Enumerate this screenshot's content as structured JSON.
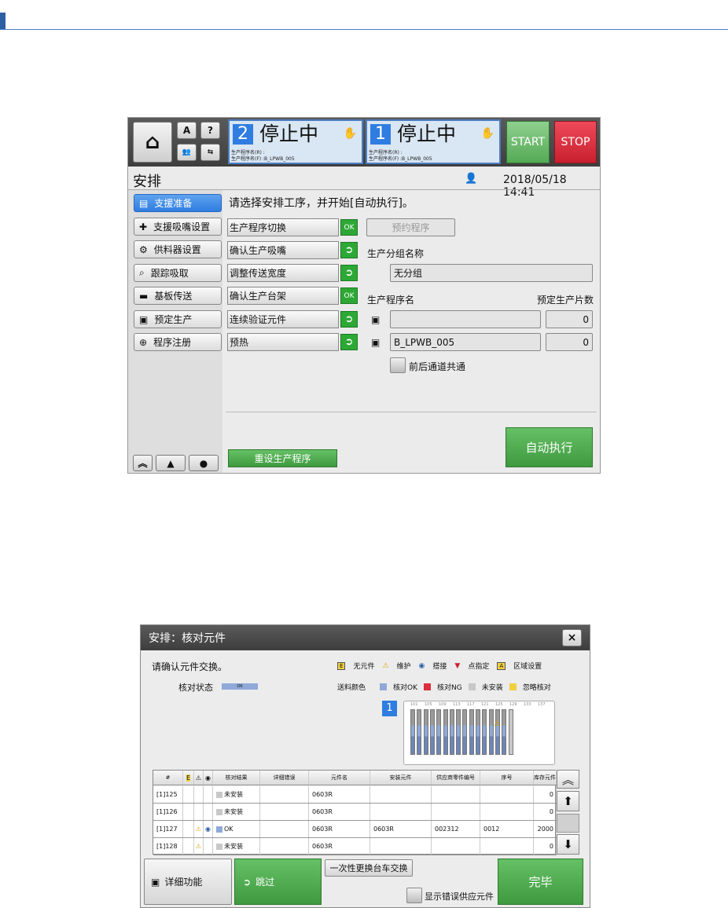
{
  "screen1": {
    "status_panels": [
      {
        "number": "2",
        "status": "停止中",
        "line1": "生产程序名(R) :",
        "line2": "生产程序名(F) :B_LPWB_005"
      },
      {
        "number": "1",
        "status": "停止中",
        "line1": "生产程序名(R) :",
        "line2": "生产程序名(F) :B_LPWB_005"
      }
    ],
    "start_label": "START",
    "stop_label": "STOP",
    "title": "安排",
    "datetime": "2018/05/18 14:41",
    "sidebar": [
      "支援准备",
      "支援吸嘴设置",
      "供料器设置",
      "跟踪吸取",
      "基板传送",
      "预定生产",
      "程序注册"
    ],
    "instruction": "请选择安排工序，并开始[自动执行]。",
    "steps": [
      {
        "label": "生产程序切换",
        "status": "OK"
      },
      {
        "label": "确认生产吸嘴",
        "status": "arrow"
      },
      {
        "label": "调整传送宽度",
        "status": "arrow"
      },
      {
        "label": "确认生产台架",
        "status": "OK"
      },
      {
        "label": "连续验证元件",
        "status": "arrow"
      },
      {
        "label": "预热",
        "status": "arrow"
      }
    ],
    "reserve_button": "预约程序",
    "group_label": "生产分组名称",
    "group_value": "无分组",
    "program_label": "生产程序名",
    "count_label": "预定生产片数",
    "programs": [
      {
        "name": "",
        "count": "0"
      },
      {
        "name": "B_LPWB_005",
        "count": "0"
      }
    ],
    "common_label": "前后通道共通",
    "reset_button": "重设生产程序",
    "auto_button": "自动执行"
  },
  "screen2": {
    "title": "安排：核对元件",
    "close": "×",
    "prompt": "请确认元件交换。",
    "legend1": [
      "无元件",
      "维护",
      "搭接",
      "点指定",
      "区域设置"
    ],
    "check_status_label": "核对状态",
    "check_status_value": "OK",
    "color_label": "送料颜色",
    "legend2": [
      "核对OK",
      "核对NG",
      "未安装",
      "忽略核对"
    ],
    "lane": "1",
    "slots": [
      "101",
      "105",
      "109",
      "113",
      "117",
      "121",
      "125",
      "129",
      "133",
      "137"
    ],
    "columns": [
      "#",
      "",
      "",
      "",
      "核对结果",
      "详细错误",
      "元件名",
      "安装元件",
      "供应商零件编号",
      "序号",
      "库存元件"
    ],
    "rows": [
      {
        "id": "[1]125",
        "warn": "",
        "link": "",
        "result": "未安装",
        "part": "0603R",
        "mounted": "",
        "vendor": "",
        "serial": "",
        "stock": "0"
      },
      {
        "id": "[1]126",
        "warn": "",
        "link": "",
        "result": "未安装",
        "part": "0603R",
        "mounted": "",
        "vendor": "",
        "serial": "",
        "stock": "0"
      },
      {
        "id": "[1]127",
        "warn": "⚠",
        "link": "◉",
        "result": "OK",
        "part": "0603R",
        "mounted": "0603R",
        "vendor": "002312",
        "serial": "0012",
        "stock": "2000"
      },
      {
        "id": "[1]128",
        "warn": "⚠",
        "link": "",
        "result": "未安装",
        "part": "0603R",
        "mounted": "",
        "vendor": "",
        "serial": "",
        "stock": "0"
      }
    ],
    "detail_button": "详细功能",
    "skip_button": "跳过",
    "exchange_button": "一次性更换台车交换",
    "show_error_label": "显示错误供应元件",
    "done_button": "完毕"
  }
}
